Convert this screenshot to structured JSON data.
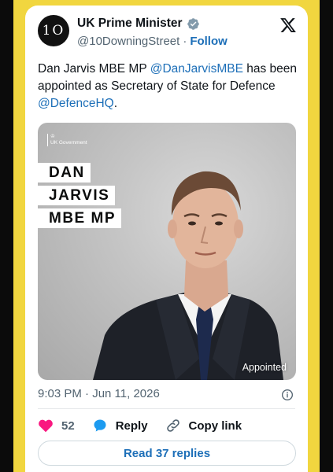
{
  "colors": {
    "accent": "#1d6fb8",
    "frame": "#f1d63f",
    "like": "#f91880"
  },
  "author": {
    "avatar_text": "1O",
    "name": "UK Prime Minister",
    "handle": "@10DowningStreet",
    "separator": "·",
    "follow_label": "Follow",
    "verified_icon": "verified-badge-icon"
  },
  "tweet": {
    "text_1": "Dan Jarvis MBE MP ",
    "mention_1": "@DanJarvisMBE",
    "text_2": " has been appointed as Secretary of State for Defence ",
    "mention_2": "@DefenceHQ",
    "text_3": "."
  },
  "media": {
    "gov_logo_text": "UK Government",
    "name_lines": [
      "DAN",
      "JARVIS",
      "MBE MP"
    ],
    "tag": "Appointed"
  },
  "meta": {
    "timestamp": "9:03 PM · Jun 11, 2026"
  },
  "actions": {
    "like_count": "52",
    "reply_label": "Reply",
    "copy_link_label": "Copy link"
  },
  "read_replies_label": "Read 37 replies"
}
